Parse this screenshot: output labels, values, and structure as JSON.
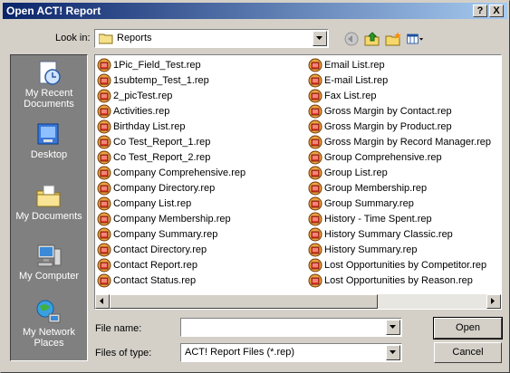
{
  "window": {
    "title": "Open ACT! Report",
    "help_label": "?",
    "close_label": "X"
  },
  "look_in": {
    "label": "Look in:",
    "value": "Reports"
  },
  "toolbar": {
    "icons": [
      "back-icon",
      "up-folder-icon",
      "new-folder-icon",
      "view-menu-icon"
    ]
  },
  "places": [
    {
      "label": "My Recent Documents",
      "icon": "recent-documents-icon"
    },
    {
      "label": "Desktop",
      "icon": "desktop-icon"
    },
    {
      "label": "My Documents",
      "icon": "my-documents-icon"
    },
    {
      "label": "My Computer",
      "icon": "my-computer-icon"
    },
    {
      "label": "My Network Places",
      "icon": "network-places-icon"
    }
  ],
  "files": {
    "column1": [
      "1Pic_Field_Test.rep",
      "1subtemp_Test_1.rep",
      "2_picTest.rep",
      "Activities.rep",
      "Birthday List.rep",
      "Co Test_Report_1.rep",
      "Co Test_Report_2.rep",
      "Company Comprehensive.rep",
      "Company Directory.rep",
      "Company List.rep",
      "Company Membership.rep",
      "Company Summary.rep",
      "Contact Directory.rep",
      "Contact Report.rep",
      "Contact Status.rep"
    ],
    "column2": [
      "Email List.rep",
      "E-mail List.rep",
      "Fax List.rep",
      "Gross Margin by Contact.rep",
      "Gross Margin by Product.rep",
      "Gross Margin by Record Manager.rep",
      "Group Comprehensive.rep",
      "Group List.rep",
      "Group Membership.rep",
      "Group Summary.rep",
      "History - Time Spent.rep",
      "History Summary Classic.rep",
      "History Summary.rep",
      "Lost Opportunities by Competitor.rep",
      "Lost Opportunities by Reason.rep"
    ]
  },
  "file_name": {
    "label": "File name:",
    "value": ""
  },
  "files_of_type": {
    "label": "Files of type:",
    "value": "ACT! Report Files (*.rep)"
  },
  "buttons": {
    "open": "Open",
    "cancel": "Cancel"
  }
}
